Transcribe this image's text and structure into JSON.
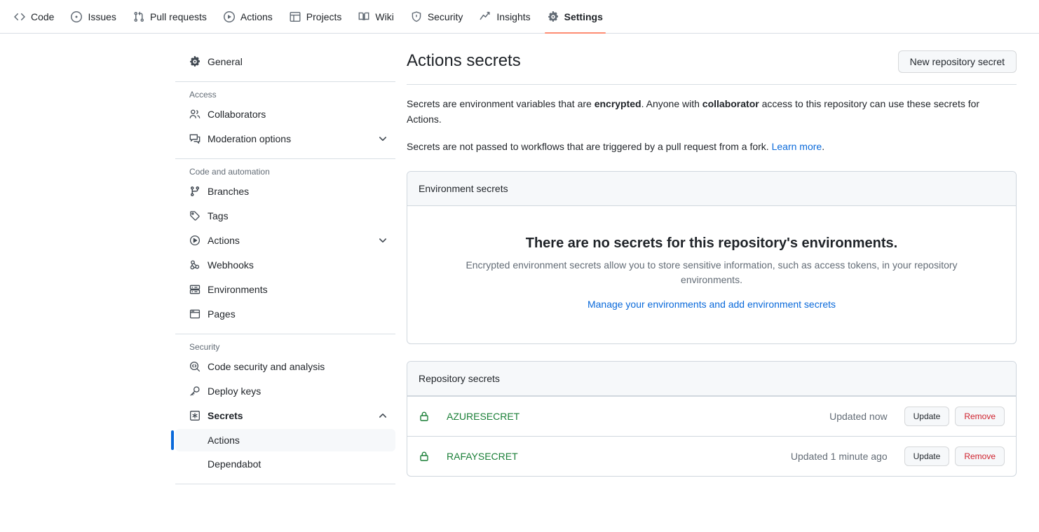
{
  "topnav": {
    "items": [
      {
        "label": "Code",
        "icon": "code-icon",
        "active": false
      },
      {
        "label": "Issues",
        "icon": "issue-opened-icon",
        "active": false
      },
      {
        "label": "Pull requests",
        "icon": "git-pull-request-icon",
        "active": false
      },
      {
        "label": "Actions",
        "icon": "play-icon",
        "active": false
      },
      {
        "label": "Projects",
        "icon": "table-icon",
        "active": false
      },
      {
        "label": "Wiki",
        "icon": "book-icon",
        "active": false
      },
      {
        "label": "Security",
        "icon": "shield-icon",
        "active": false
      },
      {
        "label": "Insights",
        "icon": "graph-icon",
        "active": false
      },
      {
        "label": "Settings",
        "icon": "gear-icon",
        "active": true
      }
    ],
    "active_accent": "#fd8c73"
  },
  "sidebar": {
    "general": {
      "label": "General",
      "icon": "gear-icon"
    },
    "sections": [
      {
        "heading": "Access",
        "items": [
          {
            "label": "Collaborators",
            "icon": "people-icon",
            "chevron": ""
          },
          {
            "label": "Moderation options",
            "icon": "comment-discussion-icon",
            "chevron": "down"
          }
        ]
      },
      {
        "heading": "Code and automation",
        "items": [
          {
            "label": "Branches",
            "icon": "git-branch-icon",
            "chevron": ""
          },
          {
            "label": "Tags",
            "icon": "tag-icon",
            "chevron": ""
          },
          {
            "label": "Actions",
            "icon": "play-icon",
            "chevron": "down"
          },
          {
            "label": "Webhooks",
            "icon": "webhook-icon",
            "chevron": ""
          },
          {
            "label": "Environments",
            "icon": "server-icon",
            "chevron": ""
          },
          {
            "label": "Pages",
            "icon": "browser-icon",
            "chevron": ""
          }
        ]
      },
      {
        "heading": "Security",
        "items": [
          {
            "label": "Code security and analysis",
            "icon": "codescan-icon",
            "chevron": ""
          },
          {
            "label": "Deploy keys",
            "icon": "key-icon",
            "chevron": ""
          },
          {
            "label": "Secrets",
            "icon": "asterisk-icon",
            "chevron": "up"
          }
        ],
        "subitems": [
          {
            "label": "Actions",
            "selected": true
          },
          {
            "label": "Dependabot",
            "selected": false
          }
        ]
      }
    ],
    "selected_accent": "#0969da"
  },
  "main": {
    "title": "Actions secrets",
    "new_secret_button": "New repository secret",
    "intro": {
      "line1_a": "Secrets are environment variables that are ",
      "line1_b": "encrypted",
      "line1_c": ". Anyone with ",
      "line1_d": "collaborator",
      "line1_e": " access to this repository can use these secrets for Actions.",
      "line2_a": "Secrets are not passed to workflows that are triggered by a pull request from a fork. ",
      "line2_link": "Learn more",
      "line2_b": "."
    },
    "environment_panel": {
      "header": "Environment secrets",
      "blank_title": "There are no secrets for this repository's environments.",
      "blank_desc": "Encrypted environment secrets allow you to store sensitive information, such as access tokens, in your repository environments.",
      "blank_link": "Manage your environments and add environment secrets"
    },
    "repository_panel": {
      "header": "Repository secrets",
      "secrets": [
        {
          "name": "AZURESECRET",
          "updated": "Updated now",
          "update_label": "Update",
          "remove_label": "Remove"
        },
        {
          "name": "RAFAYSECRET",
          "updated": "Updated 1 minute ago",
          "update_label": "Update",
          "remove_label": "Remove"
        }
      ]
    }
  },
  "colors": {
    "accent_tab": "#fd8c73",
    "link": "#0969da",
    "secret_green": "#1a7f37",
    "danger_red": "#cf222e",
    "border": "#d0d7de",
    "panel_header_bg": "#f6f8fa"
  }
}
